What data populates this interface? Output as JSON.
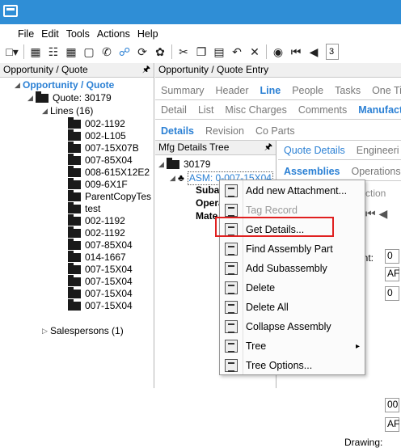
{
  "menu": [
    "File",
    "Edit",
    "Tools",
    "Actions",
    "Help"
  ],
  "toolbar": {
    "icons": [
      "new-icon",
      "save-icon",
      "book-icon",
      "grid-icon",
      "note-icon",
      "phone-icon",
      "attach-icon",
      "refresh-icon",
      "clear-icon",
      "cut-icon",
      "copy-icon",
      "paste-icon",
      "undo-icon",
      "delete-icon",
      "binoculars-icon",
      "first-icon",
      "prev-icon"
    ],
    "page_field": "3"
  },
  "left_pane": {
    "header": "Opportunity / Quote",
    "root": "Opportunity / Quote",
    "quote": "Quote: 30179",
    "lines": "Lines (16)",
    "line_items": [
      "002-1192",
      "002-L105",
      "007-15X07B",
      "007-85X04",
      "008-615X12E2",
      "009-6X1F",
      "ParentCopyTes",
      "test",
      "002-1192",
      "002-1192",
      "007-85X04",
      "014-1667",
      "007-15X04",
      "007-15X04",
      "007-15X04",
      "007-15X04"
    ],
    "salespersons": "Salespersons (1)"
  },
  "right_pane": {
    "header": "Opportunity / Quote Entry",
    "tabs1": [
      "Summary",
      "Header",
      "Line",
      "People",
      "Tasks",
      "One Tim"
    ],
    "tabs2": [
      "Detail",
      "List",
      "Misc Charges",
      "Comments",
      "Manufactu"
    ],
    "tabs3": [
      "Details",
      "Revision",
      "Co Parts"
    ],
    "mfg_tree": {
      "header": "Mfg Details Tree",
      "root": "30179",
      "asm": "ASM: 0-007-15X04",
      "children": [
        "Subas",
        "Opera",
        "Mate"
      ]
    },
    "qd_tabs": [
      "Quote Details",
      "Engineeri"
    ],
    "qd_tabs2": [
      "Assemblies",
      "Operations"
    ],
    "section": "ction",
    "labels": [
      "ent:",
      "Drawing:"
    ],
    "values": [
      "0",
      "AF",
      "0",
      "00",
      "AF"
    ]
  },
  "context_menu": {
    "items": [
      {
        "label": "Add new Attachment...",
        "icon": "attachment-icon",
        "disabled": false
      },
      {
        "label": "Tag Record",
        "icon": "tag-icon",
        "disabled": true
      },
      {
        "label": "Get Details...",
        "icon": "details-icon",
        "disabled": false
      },
      {
        "label": "Find Assembly Part",
        "icon": "find-icon",
        "disabled": false
      },
      {
        "label": "Add Subassembly",
        "icon": "subassembly-icon",
        "disabled": false
      },
      {
        "label": "Delete",
        "icon": "delete-icon",
        "disabled": false
      },
      {
        "label": "Delete All",
        "icon": "delete-all-icon",
        "disabled": false
      },
      {
        "label": "Collapse Assembly",
        "icon": "collapse-icon",
        "disabled": false
      },
      {
        "label": "Tree",
        "icon": "tree-icon",
        "disabled": false,
        "submenu": true
      },
      {
        "label": "Tree Options...",
        "icon": "tree-options-icon",
        "disabled": false
      }
    ]
  },
  "colors": {
    "titlebar": "#2f8ed6",
    "accent": "#2b80d4",
    "highlight": "#e02020"
  }
}
